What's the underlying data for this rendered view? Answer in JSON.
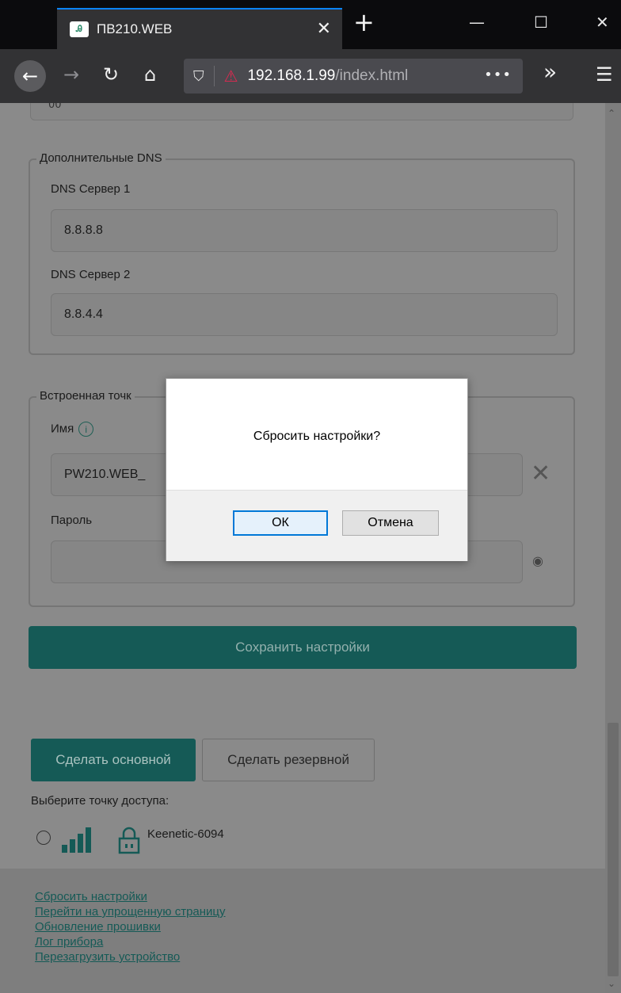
{
  "browser": {
    "tab_title": "ПВ210.WEB",
    "tab_favicon_text": "Ꭿ",
    "url_host": "192.168.1.99",
    "url_path": "/index.html",
    "url_more": "•••",
    "overflow": "»",
    "menu": "☰",
    "close_tab": "✕",
    "new_tab": "+",
    "minimize": "—",
    "maximize": "☐",
    "close_window": "✕"
  },
  "prev_input_value": "00",
  "extra_dns": {
    "legend": "Дополнительные DNS",
    "server1_label": "DNS Сервер 1",
    "server1_value": "8.8.8.8",
    "server2_label": "DNS Сервер 2",
    "server2_value": "8.8.4.4"
  },
  "access_point": {
    "legend": "Встроенная точк",
    "name_label": "Имя",
    "name_value": "PW210.WEB_",
    "password_label": "Пароль",
    "password_value": ""
  },
  "save_button": "Сохранить настройки",
  "make_primary": "Сделать основной",
  "make_backup": "Сделать резервной",
  "select_ap_label": "Выберите точку доступа:",
  "ap_list": [
    {
      "name": "Keenetic-6094",
      "selected": false
    }
  ],
  "footer_links": [
    "Сбросить настройки",
    "Перейти на упрощенную страницу",
    "Обновление прошивки",
    "Лог прибора",
    "Перезагрузить устройство"
  ],
  "dialog": {
    "message": "Сбросить настройки?",
    "ok": "ОК",
    "cancel": "Отмена"
  },
  "colors": {
    "accent": "#155a56",
    "overlay": "#8a8a8a",
    "browser_dark": "#323234",
    "focus_blue": "#0078d7"
  }
}
